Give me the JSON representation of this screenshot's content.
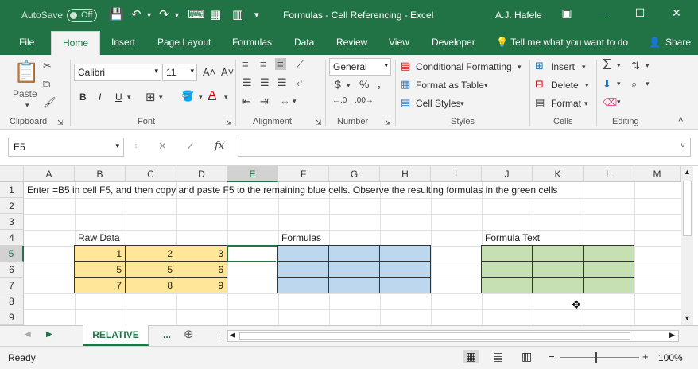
{
  "titlebar": {
    "autosave_label": "AutoSave",
    "autosave_state": "Off",
    "doc_title": "Formulas - Cell Referencing  -  Excel",
    "user": "A.J. Hafele"
  },
  "tabs": [
    "File",
    "Home",
    "Insert",
    "Page Layout",
    "Formulas",
    "Data",
    "Review",
    "View",
    "Developer"
  ],
  "tell_me": "Tell me what you want to do",
  "share": "Share",
  "ribbon": {
    "clipboard": {
      "label": "Clipboard",
      "paste": "Paste"
    },
    "font": {
      "label": "Font",
      "name": "Calibri",
      "size": "11",
      "bold": "B",
      "italic": "I",
      "underline": "U"
    },
    "alignment": {
      "label": "Alignment"
    },
    "number": {
      "label": "Number",
      "format": "General"
    },
    "styles": {
      "label": "Styles",
      "conditional": "Conditional Formatting",
      "format_table": "Format as Table",
      "cell_styles": "Cell Styles"
    },
    "cells": {
      "label": "Cells",
      "insert": "Insert",
      "delete": "Delete",
      "format": "Format"
    },
    "editing": {
      "label": "Editing"
    }
  },
  "formula_bar": {
    "name_box": "E5",
    "fx": "fx",
    "content": ""
  },
  "columns": [
    "A",
    "B",
    "C",
    "D",
    "E",
    "F",
    "G",
    "H",
    "I",
    "J",
    "K",
    "L",
    "M"
  ],
  "rows": [
    "1",
    "2",
    "3",
    "4",
    "5",
    "6",
    "7",
    "8",
    "9"
  ],
  "cells": {
    "A1": "Enter =B5 in cell F5, and then copy and paste F5 to the remaining blue cells.  Observe the resulting formulas in the green cells",
    "B4": "Raw Data",
    "F4": "Formulas",
    "J4": "Formula Text",
    "raw": [
      [
        "1",
        "2",
        "3"
      ],
      [
        "5",
        "5",
        "6"
      ],
      [
        "7",
        "8",
        "9"
      ]
    ]
  },
  "sheet_tab": "RELATIVE",
  "sheet_more": "...",
  "status": {
    "ready": "Ready",
    "zoom": "100%"
  }
}
